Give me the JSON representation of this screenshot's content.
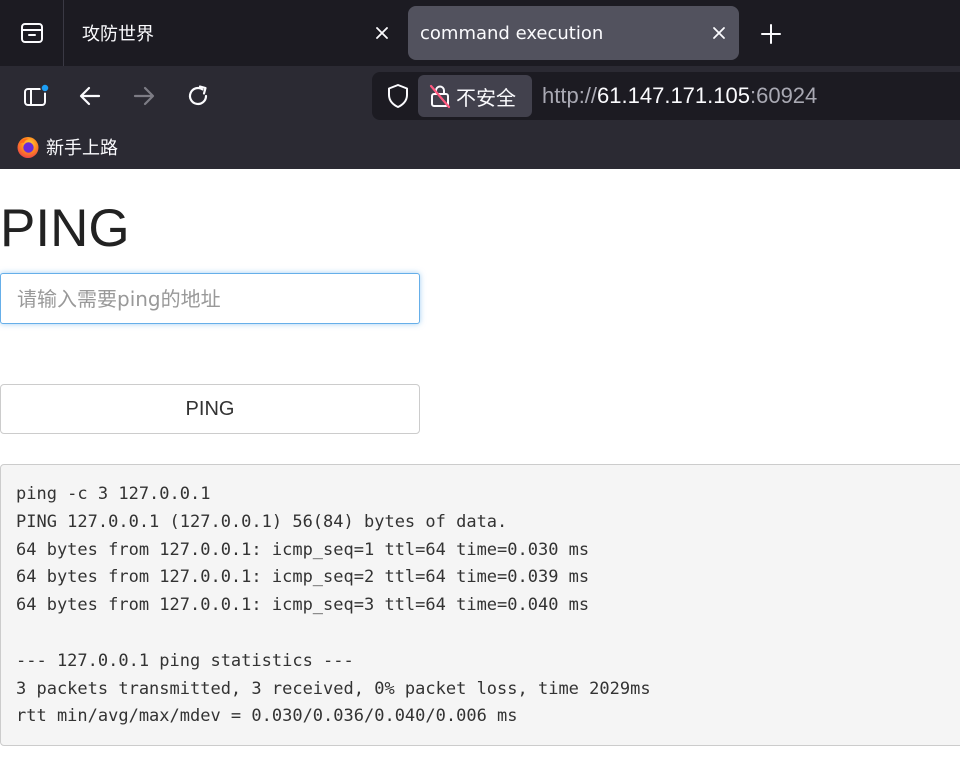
{
  "browser": {
    "tabs": [
      {
        "title": "攻防世界",
        "active": false
      },
      {
        "title": "command execution",
        "active": true
      }
    ],
    "address_bar": {
      "security_label": "不安全",
      "scheme": "http://",
      "host": "61.147.171.105",
      "port": ":60924"
    },
    "bookmarks": [
      {
        "label": "新手上路"
      }
    ]
  },
  "page": {
    "title": "PING",
    "address_input": {
      "placeholder": "请输入需要ping的地址",
      "value": ""
    },
    "ping_button_label": "PING",
    "output_lines": [
      "ping -c 3 127.0.0.1",
      "PING 127.0.0.1 (127.0.0.1) 56(84) bytes of data.",
      "64 bytes from 127.0.0.1: icmp_seq=1 ttl=64 time=0.030 ms",
      "64 bytes from 127.0.0.1: icmp_seq=2 ttl=64 time=0.039 ms",
      "64 bytes from 127.0.0.1: icmp_seq=3 ttl=64 time=0.040 ms",
      "",
      "--- 127.0.0.1 ping statistics ---",
      "3 packets transmitted, 3 received, 0% packet loss, time 2029ms",
      "rtt min/avg/max/mdev = 0.030/0.036/0.040/0.006 ms"
    ]
  },
  "icons": {
    "tab_overview": "folder-icon",
    "tab_close": "close-icon",
    "new_tab": "plus-icon",
    "sidebar": "sidebar-icon",
    "back": "back-arrow-icon",
    "forward": "forward-arrow-icon",
    "reload": "reload-icon",
    "shield": "shield-icon",
    "insecure_lock": "lock-insecure-icon",
    "bookmark": "firefox-icon"
  },
  "colors": {
    "tab_strip_bg": "#1c1b22",
    "toolbar_bg": "#2b2a33",
    "active_tab_bg": "#52525e",
    "focus_ring": "#66afe9",
    "pre_bg": "#f5f5f5"
  }
}
